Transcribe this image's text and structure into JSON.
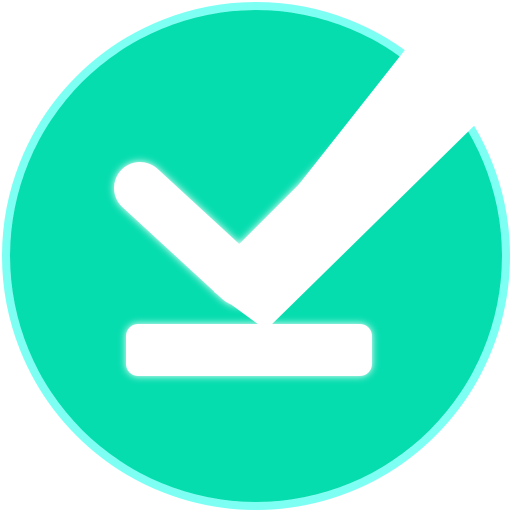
{
  "icon": {
    "name": "check-underline-circle-icon",
    "accent_color": "#05DDAF",
    "glow_color": "#7EFFF4",
    "mark_color": "#FFFFFF",
    "background_color": "#FFFFFF"
  }
}
